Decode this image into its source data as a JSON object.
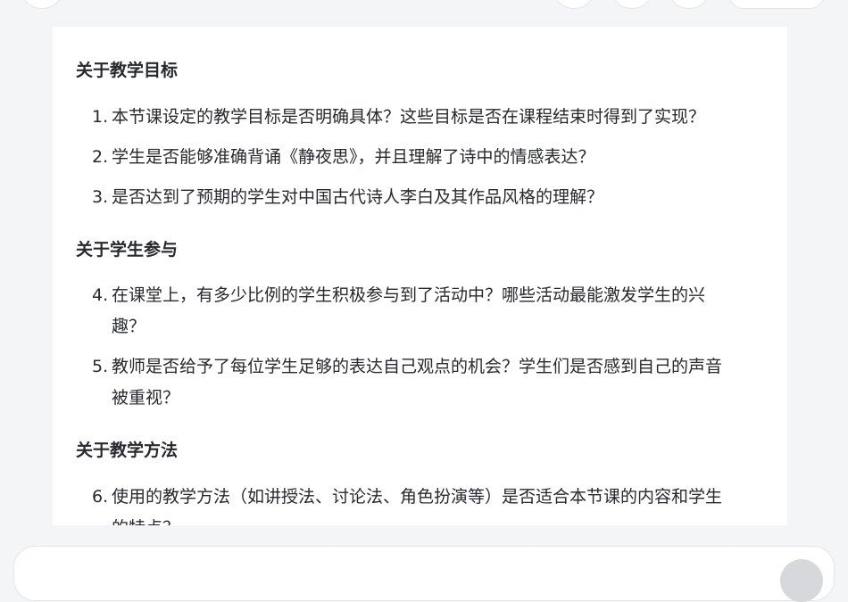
{
  "header": {
    "title": "",
    "left_button_icon": "back-icon",
    "right_icons": [
      "circle-icon-1",
      "circle-icon-2",
      "circle-icon-3"
    ],
    "pill_label": ""
  },
  "sections": [
    {
      "heading": "关于教学目标",
      "items": [
        {
          "num": "1.",
          "lines": [
            "本节课设定的教学目标是否明确具体？这些目标是否在课程结束时得到了实现？"
          ]
        },
        {
          "num": "2.",
          "lines": [
            "学生是否能够准确背诵《静夜思》，并且理解了诗中的情感表达？"
          ]
        },
        {
          "num": "3.",
          "lines": [
            "是否达到了预期的学生对中国古代诗人李白及其作品风格的理解？"
          ]
        }
      ]
    },
    {
      "heading": "关于学生参与",
      "items": [
        {
          "num": "4.",
          "lines": [
            "在课堂上，有多少比例的学生积极参与到了活动中？哪些活动最能激发学生的兴",
            "趣？"
          ]
        },
        {
          "num": "5.",
          "lines": [
            "教师是否给予了每位学生足够的表达自己观点的机会？学生们是否感到自己的声音",
            "被重视？"
          ]
        }
      ]
    },
    {
      "heading": "关于教学方法",
      "items": [
        {
          "num": "6.",
          "lines": [
            "使用的教学方法（如讲授法、讨论法、角色扮演等）是否适合本节课的内容和学生",
            "的特点？"
          ]
        }
      ]
    }
  ],
  "composer": {
    "placeholder": "",
    "send_icon": "send-icon"
  }
}
